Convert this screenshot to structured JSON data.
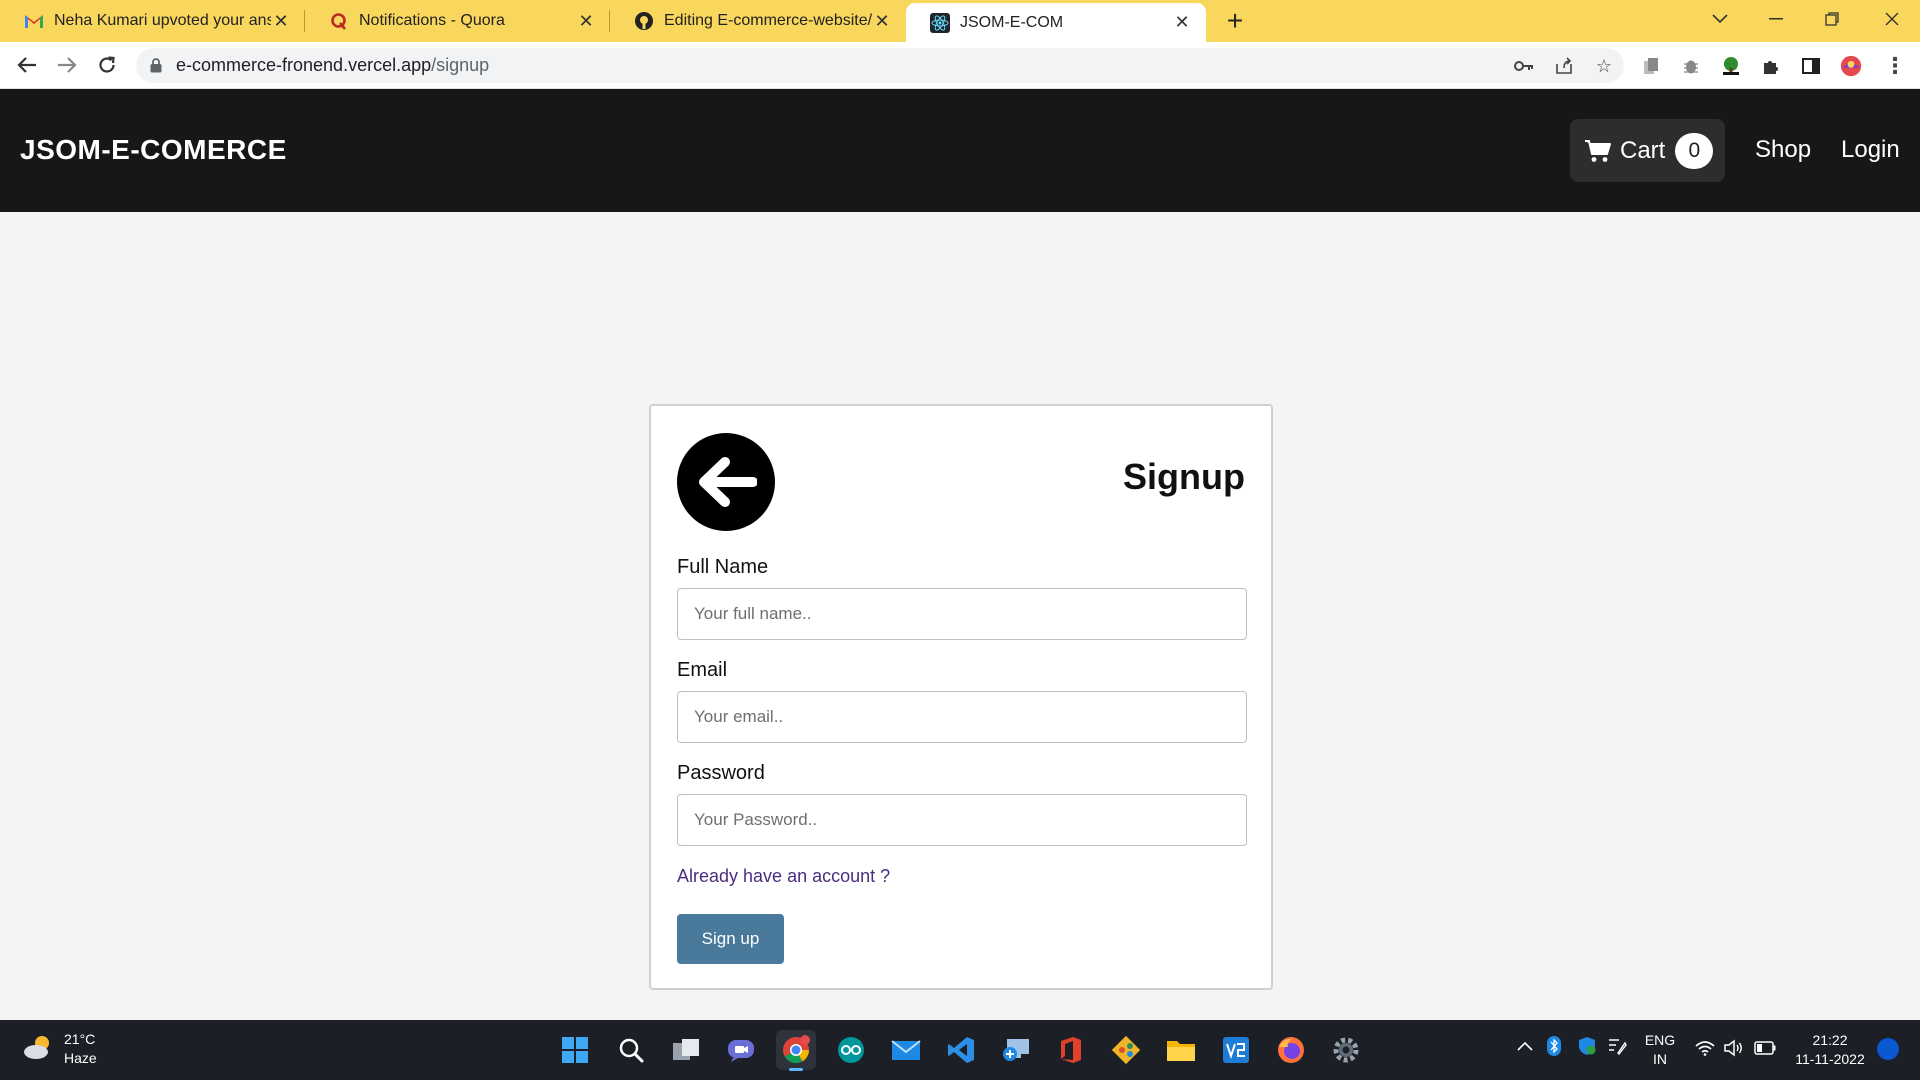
{
  "browser": {
    "tabs": [
      {
        "title": "Neha Kumari upvoted your answ",
        "icon": "gmail-icon"
      },
      {
        "title": "Notifications - Quora",
        "icon": "quora-icon"
      },
      {
        "title": "Editing E-commerce-website/RE/",
        "icon": "github-icon"
      },
      {
        "title": "JSOM-E-COM",
        "icon": "react-icon",
        "active": true
      }
    ],
    "url_host": "e-commerce-fronend.vercel.app",
    "url_path": "/signup"
  },
  "site": {
    "brand": "JSOM-E-COMERCE",
    "cart_label": "Cart",
    "cart_count": "0",
    "nav": {
      "shop": "Shop",
      "login": "Login"
    }
  },
  "signup": {
    "title": "Signup",
    "fields": {
      "full_name": {
        "label": "Full Name",
        "placeholder": "Your full name..",
        "value": ""
      },
      "email": {
        "label": "Email",
        "placeholder": "Your email..",
        "value": ""
      },
      "password": {
        "label": "Password",
        "placeholder": "Your Password..",
        "value": ""
      }
    },
    "login_link": "Already have an account ?",
    "submit": "Sign up"
  },
  "taskbar": {
    "weather": {
      "temp": "21°C",
      "condition": "Haze"
    },
    "language": {
      "lang": "ENG",
      "region": "IN"
    },
    "clock": {
      "time": "21:22",
      "date": "11-11-2022"
    }
  },
  "colors": {
    "tabstrip": "#f9d65c",
    "header": "#171717",
    "page_bg": "#f4f4f4",
    "button": "#4a7a9b",
    "link": "#4b2d7f"
  }
}
